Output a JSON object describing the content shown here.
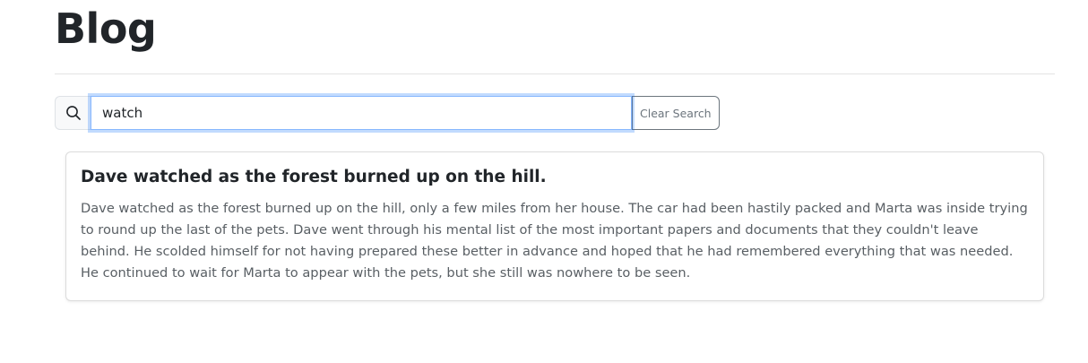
{
  "page": {
    "title": "Blog"
  },
  "search": {
    "value": "watch",
    "placeholder": "",
    "icon": "search-icon",
    "clear_label": "Clear Search"
  },
  "results": [
    {
      "title": "Dave watched as the forest burned up on the hill.",
      "body": "Dave watched as the forest burned up on the hill, only a few miles from her house. The car had been hastily packed and Marta was inside trying to round up the last of the pets. Dave went through his mental list of the most important papers and documents that they couldn't leave behind. He scolded himself for not having prepared these better in advance and hoped that he had remembered everything that was needed. He continued to wait for Marta to appear with the pets, but she still was nowhere to be seen."
    }
  ],
  "colors": {
    "focus_border": "#86b7fe",
    "secondary": "#6c757d",
    "text": "#212529"
  }
}
